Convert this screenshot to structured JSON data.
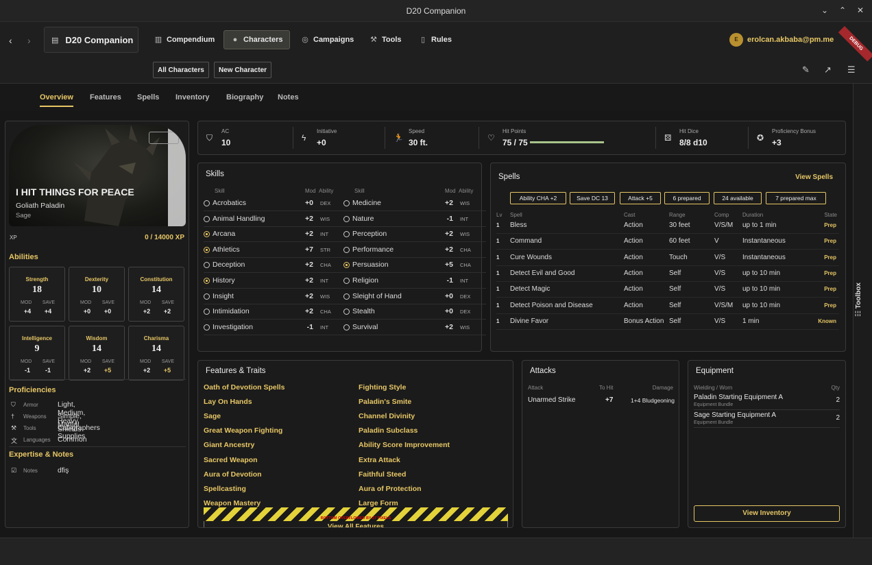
{
  "window": {
    "title": "D20 Companion"
  },
  "nav": {
    "brand": "D20 Companion",
    "items": [
      "Compendium",
      "Characters",
      "Campaigns",
      "Tools",
      "Rules"
    ],
    "user": "erolcan.akbaba@pm.me",
    "avatar_initial": "E",
    "debug": "DEBUG"
  },
  "subnav": {
    "all": "All Characters",
    "new": "New Character"
  },
  "tabs": [
    "Overview",
    "Features",
    "Spells",
    "Inventory",
    "Biography",
    "Notes"
  ],
  "character": {
    "name": "I HIT THINGS FOR PEACE",
    "subtitle": "Goliath Paladin",
    "background": "Sage",
    "xp_label": "XP",
    "xp_value": "0 / 14000 XP"
  },
  "abilities_title": "Abilities",
  "abilities": [
    {
      "name": "Strength",
      "score": "18",
      "mod": "+4",
      "save": "+4",
      "save_prof": false
    },
    {
      "name": "Dexterity",
      "score": "10",
      "mod": "+0",
      "save": "+0",
      "save_prof": false
    },
    {
      "name": "Constitution",
      "score": "14",
      "mod": "+2",
      "save": "+2",
      "save_prof": false
    },
    {
      "name": "Intelligence",
      "score": "9",
      "mod": "-1",
      "save": "-1",
      "save_prof": false
    },
    {
      "name": "Wisdom",
      "score": "14",
      "mod": "+2",
      "save": "+5",
      "save_prof": true
    },
    {
      "name": "Charisma",
      "score": "14",
      "mod": "+2",
      "save": "+5",
      "save_prof": true
    }
  ],
  "ability_labels": {
    "mod": "MOD",
    "save": "SAVE"
  },
  "proficiencies": {
    "title": "Proficiencies",
    "rows": [
      {
        "label": "Armor",
        "value": "Light, Medium, Heavy, Shields"
      },
      {
        "label": "Weapons",
        "value": "Simple, Martial"
      },
      {
        "label": "Tools",
        "value": "Calligraphers Supplies"
      },
      {
        "label": "Languages",
        "value": "Common"
      }
    ]
  },
  "expertise": {
    "title": "Expertise & Notes",
    "label": "Notes",
    "value": "dfiş"
  },
  "stats": [
    {
      "label": "AC",
      "value": "10",
      "icon": "shield-icon"
    },
    {
      "label": "Initiative",
      "value": "+0",
      "icon": "bolt-icon"
    },
    {
      "label": "Speed",
      "value": "30 ft.",
      "icon": "running-icon"
    },
    {
      "label": "Hit Points",
      "value": "75 / 75",
      "icon": "heart-icon",
      "fill": 1.0
    },
    {
      "label": "Hit Dice",
      "value": "8/8 d10",
      "icon": "dice-icon"
    },
    {
      "label": "Proficiency Bonus",
      "value": "+3",
      "icon": "medal-icon"
    }
  ],
  "skills": {
    "title": "Skills",
    "headers": {
      "skill": "Skill",
      "mod": "Mod",
      "ability": "Ability"
    },
    "left": [
      {
        "name": "Acrobatics",
        "mod": "+0",
        "ability": "DEX",
        "prof": false
      },
      {
        "name": "Animal Handling",
        "mod": "+2",
        "ability": "WIS",
        "prof": false
      },
      {
        "name": "Arcana",
        "mod": "+2",
        "ability": "INT",
        "prof": true
      },
      {
        "name": "Athletics",
        "mod": "+7",
        "ability": "STR",
        "prof": true
      },
      {
        "name": "Deception",
        "mod": "+2",
        "ability": "CHA",
        "prof": false
      },
      {
        "name": "History",
        "mod": "+2",
        "ability": "INT",
        "prof": true
      },
      {
        "name": "Insight",
        "mod": "+2",
        "ability": "WIS",
        "prof": false
      },
      {
        "name": "Intimidation",
        "mod": "+2",
        "ability": "CHA",
        "prof": false
      },
      {
        "name": "Investigation",
        "mod": "-1",
        "ability": "INT",
        "prof": false
      }
    ],
    "right": [
      {
        "name": "Medicine",
        "mod": "+2",
        "ability": "WIS",
        "prof": false
      },
      {
        "name": "Nature",
        "mod": "-1",
        "ability": "INT",
        "prof": false
      },
      {
        "name": "Perception",
        "mod": "+2",
        "ability": "WIS",
        "prof": false
      },
      {
        "name": "Performance",
        "mod": "+2",
        "ability": "CHA",
        "prof": false
      },
      {
        "name": "Persuasion",
        "mod": "+5",
        "ability": "CHA",
        "prof": true
      },
      {
        "name": "Religion",
        "mod": "-1",
        "ability": "INT",
        "prof": false
      },
      {
        "name": "Sleight of Hand",
        "mod": "+0",
        "ability": "DEX",
        "prof": false
      },
      {
        "name": "Stealth",
        "mod": "+0",
        "ability": "DEX",
        "prof": false
      },
      {
        "name": "Survival",
        "mod": "+2",
        "ability": "WIS",
        "prof": false
      }
    ]
  },
  "spells": {
    "title": "Spells",
    "view": "View Spells",
    "chips": [
      "Ability CHA +2",
      "Save DC 13",
      "Attack +5",
      "6 prepared",
      "24 available",
      "7 prepared max"
    ],
    "headers": {
      "lv": "Lv",
      "spell": "Spell",
      "cast": "Cast",
      "range": "Range",
      "comp": "Comp",
      "duration": "Duration",
      "state": "State"
    },
    "rows": [
      {
        "lv": "1",
        "spell": "Bless",
        "cast": "Action",
        "range": "30 feet",
        "comp": "V/S/M",
        "duration": "up to 1 min",
        "state": "Prep"
      },
      {
        "lv": "1",
        "spell": "Command",
        "cast": "Action",
        "range": "60 feet",
        "comp": "V",
        "duration": "Instantaneous",
        "state": "Prep"
      },
      {
        "lv": "1",
        "spell": "Cure Wounds",
        "cast": "Action",
        "range": "Touch",
        "comp": "V/S",
        "duration": "Instantaneous",
        "state": "Prep"
      },
      {
        "lv": "1",
        "spell": "Detect Evil and Good",
        "cast": "Action",
        "range": "Self",
        "comp": "V/S",
        "duration": "up to 10 min",
        "state": "Prep"
      },
      {
        "lv": "1",
        "spell": "Detect Magic",
        "cast": "Action",
        "range": "Self",
        "comp": "V/S",
        "duration": "up to 10 min",
        "state": "Prep"
      },
      {
        "lv": "1",
        "spell": "Detect Poison and Disease",
        "cast": "Action",
        "range": "Self",
        "comp": "V/S/M",
        "duration": "up to 10 min",
        "state": "Prep"
      },
      {
        "lv": "1",
        "spell": "Divine Favor",
        "cast": "Bonus Action",
        "range": "Self",
        "comp": "V/S",
        "duration": "1 min",
        "state": "Known"
      }
    ]
  },
  "features": {
    "title": "Features & Traits",
    "left": [
      "Oath of Devotion Spells",
      "Lay On Hands",
      "Sage",
      "Great Weapon Fighting",
      "Giant Ancestry",
      "Sacred Weapon",
      "Aura of Devotion",
      "Spellcasting",
      "Weapon Mastery"
    ],
    "right": [
      "Fighting Style",
      "Paladin's Smite",
      "Channel Divinity",
      "Paladin Subclass",
      "Ability Score Improvement",
      "Extra Attack",
      "Faithful Steed",
      "Aura of Protection",
      "Large Form"
    ],
    "overflow": "BOTTOM OVERFLOWED BY 27 PIXELS",
    "view_all": "View All Features"
  },
  "attacks": {
    "title": "Attacks",
    "headers": {
      "attack": "Attack",
      "tohit": "To Hit",
      "damage": "Damage"
    },
    "rows": [
      {
        "attack": "Unarmed Strike",
        "tohit": "+7",
        "damage": "1+4 Bludgeoning"
      }
    ]
  },
  "equipment": {
    "title": "Equipment",
    "headers": {
      "item": "Wielding / Worn",
      "qty": "Qty"
    },
    "rows": [
      {
        "name": "Paladin Starting Equipment A",
        "type": "Equipment Bundle",
        "qty": "2"
      },
      {
        "name": "Sage Starting Equipment A",
        "type": "Equipment Bundle",
        "qty": "2"
      }
    ],
    "view": "View Inventory"
  },
  "toolbox": "Toolbox",
  "colors": {
    "accent": "#e7c766",
    "hp_bar": "#a8c48a"
  }
}
